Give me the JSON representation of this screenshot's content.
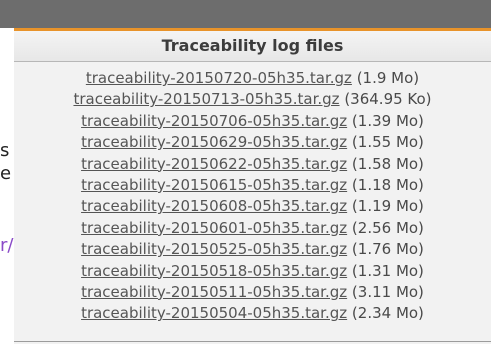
{
  "background": {
    "fragments": [
      "s",
      "e",
      "r/"
    ]
  },
  "panel": {
    "title": "Traceability log files",
    "accent_color": "#e8932a",
    "files": [
      {
        "name": "traceability-20150720-05h35.tar.gz",
        "size": "(1.9 Mo)"
      },
      {
        "name": "traceability-20150713-05h35.tar.gz",
        "size": "(364.95 Ko)"
      },
      {
        "name": "traceability-20150706-05h35.tar.gz",
        "size": "(1.39 Mo)"
      },
      {
        "name": "traceability-20150629-05h35.tar.gz",
        "size": "(1.55 Mo)"
      },
      {
        "name": "traceability-20150622-05h35.tar.gz",
        "size": "(1.58 Mo)"
      },
      {
        "name": "traceability-20150615-05h35.tar.gz",
        "size": "(1.18 Mo)"
      },
      {
        "name": "traceability-20150608-05h35.tar.gz",
        "size": "(1.19 Mo)"
      },
      {
        "name": "traceability-20150601-05h35.tar.gz",
        "size": "(2.56 Mo)"
      },
      {
        "name": "traceability-20150525-05h35.tar.gz",
        "size": "(1.76 Mo)"
      },
      {
        "name": "traceability-20150518-05h35.tar.gz",
        "size": "(1.31 Mo)"
      },
      {
        "name": "traceability-20150511-05h35.tar.gz",
        "size": "(3.11 Mo)"
      },
      {
        "name": "traceability-20150504-05h35.tar.gz",
        "size": "(2.34 Mo)"
      }
    ]
  }
}
